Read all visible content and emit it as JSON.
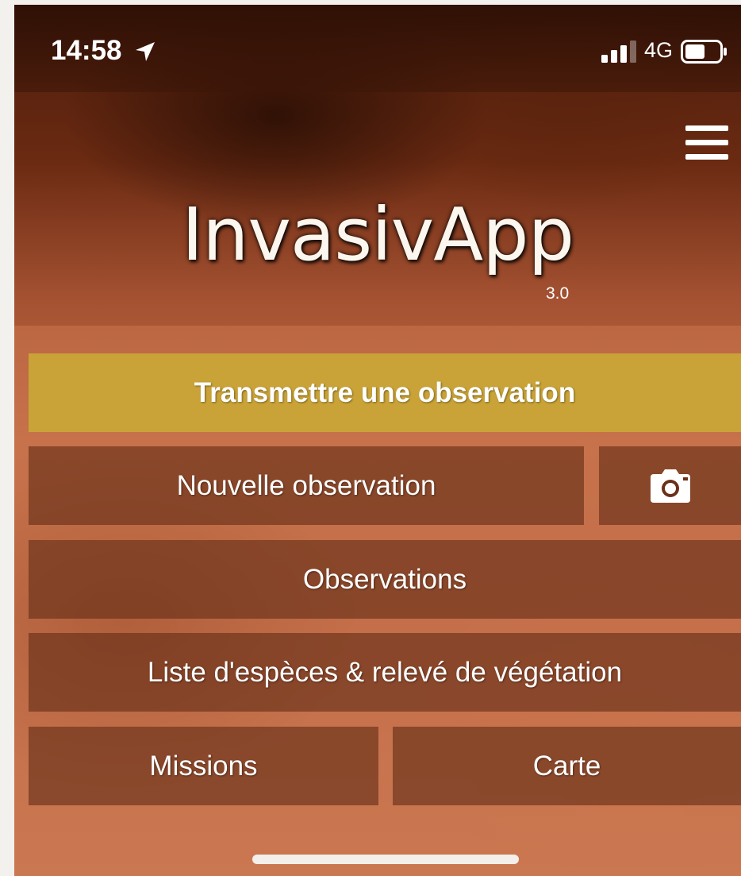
{
  "status_bar": {
    "time": "14:58",
    "network": "4G",
    "icons": [
      "location-arrow-icon",
      "signal-icon",
      "battery-icon"
    ]
  },
  "header": {
    "menu_icon": "hamburger-menu-icon",
    "app_name": "InvasivApp",
    "version": "3.0"
  },
  "buttons": {
    "primary": "Transmettre une observation",
    "new_observation": "Nouvelle observation",
    "camera_icon": "camera-icon",
    "observations": "Observations",
    "species_list": "Liste d'espèces & relevé de végétation",
    "missions": "Missions",
    "map": "Carte"
  },
  "colors": {
    "primary_button": "#c9a337",
    "button_bg": "#64301a",
    "text": "#ffffff"
  }
}
